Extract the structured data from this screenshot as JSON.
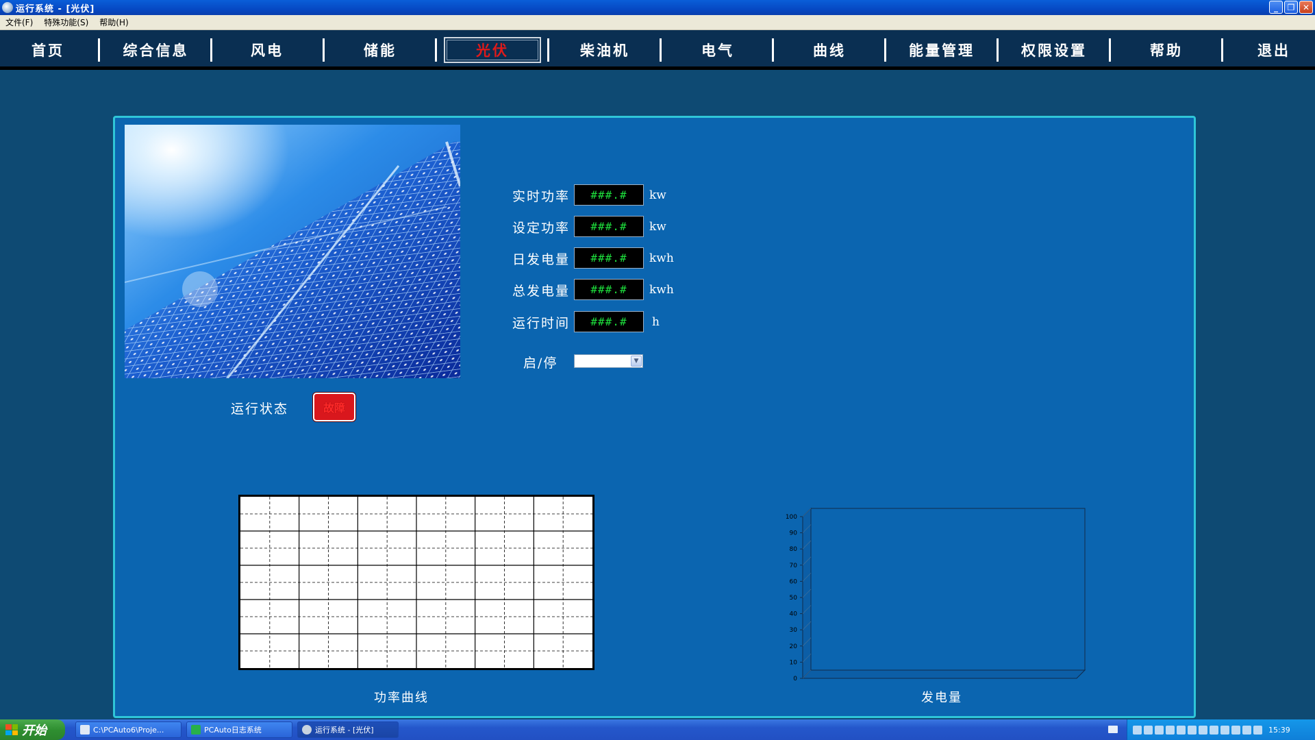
{
  "window": {
    "title": "运行系统 - [光伏]"
  },
  "menu": {
    "items": [
      "文件(F)",
      "特殊功能(S)",
      "帮助(H)"
    ]
  },
  "nav": {
    "tabs": [
      "首页",
      "综合信息",
      "风电",
      "储能",
      "光伏",
      "柴油机",
      "电气",
      "曲线",
      "能量管理",
      "权限设置",
      "帮助",
      "退出"
    ],
    "active": "光伏"
  },
  "readings": {
    "realtime_power": {
      "label": "实时功率",
      "value": "###.#",
      "unit": "kw"
    },
    "set_power": {
      "label": "设定功率",
      "value": "###.#",
      "unit": "kw"
    },
    "daily_energy": {
      "label": "日发电量",
      "value": "###.#",
      "unit": "kwh"
    },
    "total_energy": {
      "label": "总发电量",
      "value": "###.#",
      "unit": "kwh"
    },
    "run_time": {
      "label": "运行时间",
      "value": "###.#",
      "unit": "h"
    }
  },
  "start_stop": {
    "label": "启/停",
    "value": ""
  },
  "status": {
    "label": "运行状态",
    "indicator": "故障",
    "color": "#d9171d"
  },
  "charts": {
    "power_curve": {
      "title": "功率曲线"
    },
    "energy": {
      "title": "发电量",
      "ylim": [
        0,
        100
      ],
      "yticks": [
        "0",
        "10",
        "20",
        "30",
        "40",
        "50",
        "60",
        "70",
        "80",
        "90",
        "100"
      ]
    }
  },
  "taskbar": {
    "start_label": "开始",
    "items": [
      "C:\\PCAuto6\\Proje...",
      "PCAuto日志系统",
      "运行系统 - [光伏]"
    ],
    "clock": "15:39"
  },
  "colors": {
    "panel": "#0b65b0",
    "panel_border": "#2fc6d8",
    "nav_bg": "#0a2f52",
    "value_text": "#1ddf3c",
    "active_tab": "#e01a1a"
  }
}
